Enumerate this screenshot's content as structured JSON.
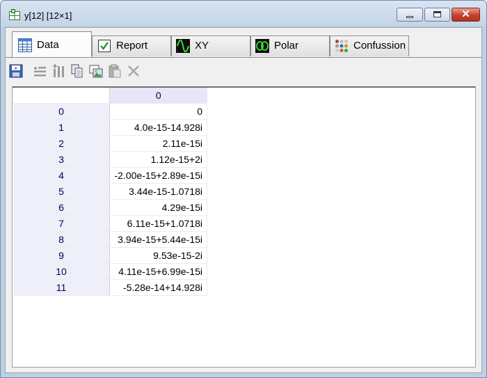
{
  "window": {
    "title": "y[12] [12×1]",
    "close_glyph": "✕"
  },
  "tabs": [
    {
      "label": "Data",
      "icon": "table-icon",
      "active": true
    },
    {
      "label": "Report",
      "icon": "checkbox-icon",
      "active": false
    },
    {
      "label": "XY",
      "icon": "waveform-icon",
      "active": false
    },
    {
      "label": "Polar",
      "icon": "polar-plot-icon",
      "active": false
    },
    {
      "label": "Confussion",
      "icon": "dots-grid-icon",
      "active": false
    }
  ],
  "toolbar": [
    "save-icon",
    "add-rows-icon",
    "add-columns-icon",
    "copy-icon",
    "image-icon",
    "paste-icon",
    "delete-icon"
  ],
  "grid": {
    "column_header": "0",
    "rows": [
      {
        "index": "0",
        "value": "0"
      },
      {
        "index": "1",
        "value": "4.0e-15-14.928i"
      },
      {
        "index": "2",
        "value": "2.11e-15i"
      },
      {
        "index": "3",
        "value": "1.12e-15+2i"
      },
      {
        "index": "4",
        "value": "-2.00e-15+2.89e-15i"
      },
      {
        "index": "5",
        "value": "3.44e-15-1.0718i"
      },
      {
        "index": "6",
        "value": "4.29e-15i"
      },
      {
        "index": "7",
        "value": "6.11e-15+1.0718i"
      },
      {
        "index": "8",
        "value": "3.94e-15+5.44e-15i"
      },
      {
        "index": "9",
        "value": "9.53e-15-2i"
      },
      {
        "index": "10",
        "value": "4.11e-15+6.99e-15i"
      },
      {
        "index": "11",
        "value": "-5.28e-14+14.928i"
      }
    ]
  },
  "colors": {
    "accent": "#00004f",
    "row_header_bg": "#efeff9",
    "col_header_bg": "#e6e6f8"
  }
}
